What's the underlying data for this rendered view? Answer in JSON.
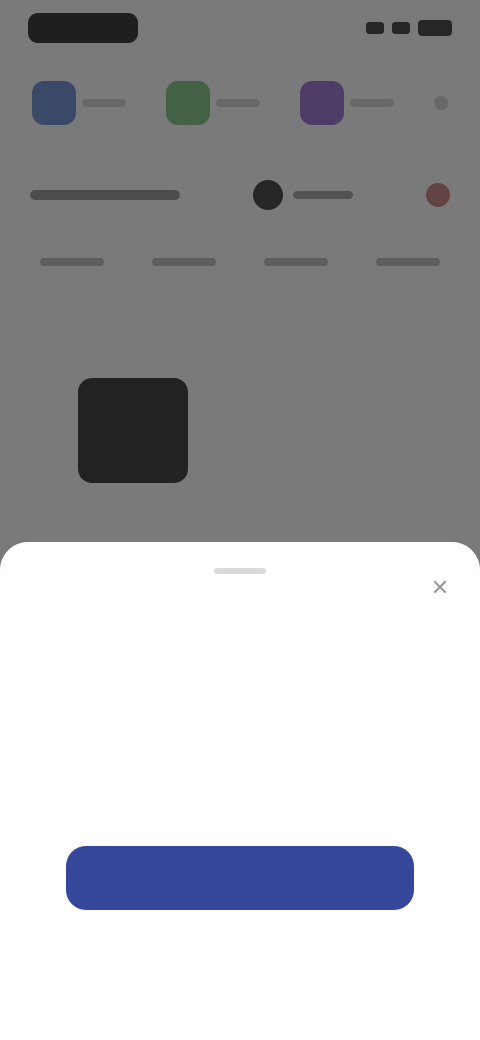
{
  "status_bar": {
    "time": "",
    "colors": {
      "foreground": "#111111"
    }
  },
  "apps": [
    {
      "icon": "app-icon-blue",
      "color": "#5b7fd0",
      "label": ""
    },
    {
      "icon": "app-icon-green",
      "color": "#6fbf73",
      "label": ""
    },
    {
      "icon": "app-icon-purple",
      "color": "#8a5cc8",
      "label": ""
    },
    {
      "icon": "more-icon",
      "color": "#d0d0d0",
      "label": ""
    }
  ],
  "tabs": [
    "",
    "",
    "",
    ""
  ],
  "sheet": {
    "title": "",
    "body": "",
    "primary_button": "",
    "secondary_link": "",
    "close_icon": "close-icon",
    "colors": {
      "title": "#2b3a6e",
      "button": "#34479a"
    }
  }
}
